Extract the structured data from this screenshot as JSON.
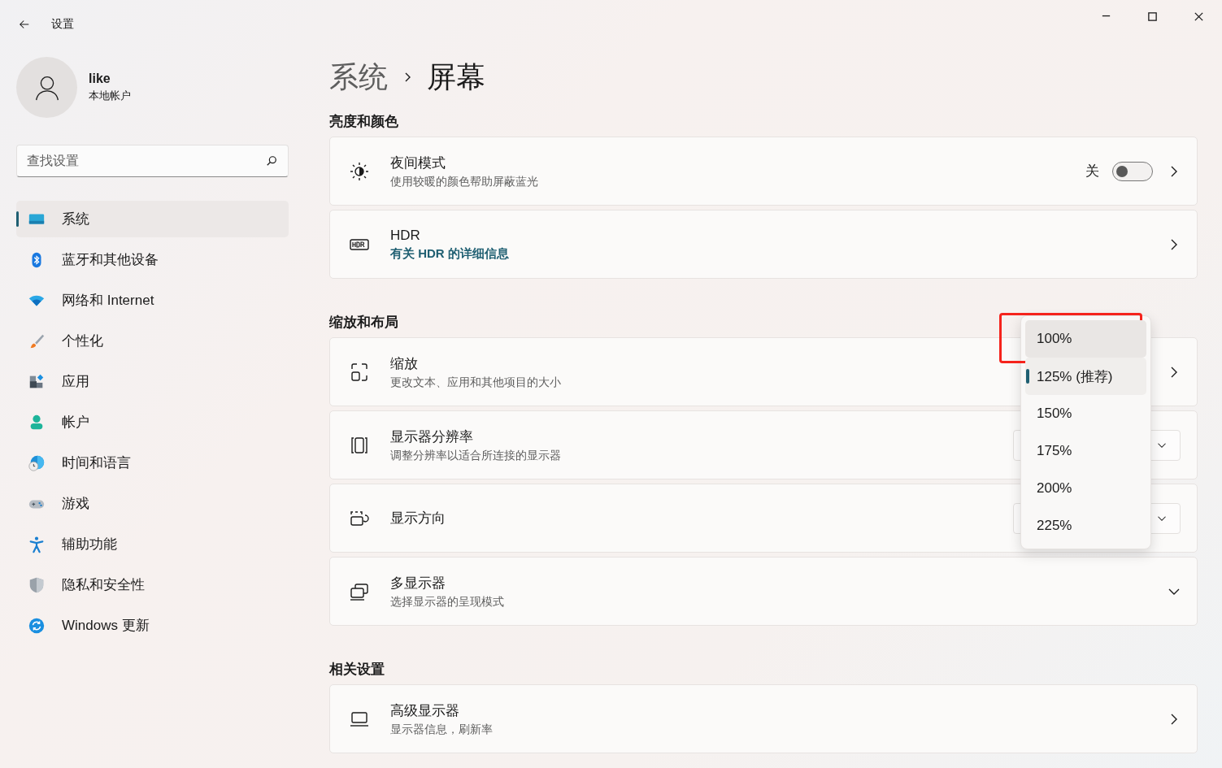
{
  "window": {
    "title": "设置"
  },
  "user": {
    "name": "like",
    "account_type": "本地帐户"
  },
  "search": {
    "placeholder": "查找设置"
  },
  "sidebar": {
    "items": [
      {
        "label": "系统",
        "selected": true
      },
      {
        "label": "蓝牙和其他设备",
        "selected": false
      },
      {
        "label": "网络和 Internet",
        "selected": false
      },
      {
        "label": "个性化",
        "selected": false
      },
      {
        "label": "应用",
        "selected": false
      },
      {
        "label": "帐户",
        "selected": false
      },
      {
        "label": "时间和语言",
        "selected": false
      },
      {
        "label": "游戏",
        "selected": false
      },
      {
        "label": "辅助功能",
        "selected": false
      },
      {
        "label": "隐私和安全性",
        "selected": false
      },
      {
        "label": "Windows 更新",
        "selected": false
      }
    ]
  },
  "breadcrumb": {
    "parent": "系统",
    "current": "屏幕"
  },
  "sections": [
    {
      "heading": "亮度和颜色",
      "cards": [
        {
          "kind": "toggle",
          "title": "夜间模式",
          "subtitle": "使用较暖的颜色帮助屏蔽蓝光",
          "toggle_label": "关",
          "on": false
        },
        {
          "kind": "link",
          "title": "HDR",
          "link": "有关 HDR 的详细信息"
        }
      ]
    },
    {
      "heading": "缩放和布局",
      "cards": [
        {
          "kind": "nav",
          "title": "缩放",
          "subtitle": "更改文本、应用和其他项目的大小"
        },
        {
          "kind": "combo",
          "title": "显示器分辨率",
          "subtitle": "调整分辨率以适合所连接的显示器"
        },
        {
          "kind": "combo",
          "title": "显示方向"
        },
        {
          "kind": "expander",
          "title": "多显示器",
          "subtitle": "选择显示器的呈现模式",
          "expanded": false
        }
      ]
    },
    {
      "heading": "相关设置",
      "cards": [
        {
          "kind": "nav",
          "title": "高级显示器",
          "subtitle": "显示器信息，刷新率"
        }
      ]
    }
  ],
  "scale_menu": {
    "items": [
      {
        "label": "100%",
        "selected": false,
        "hovered": true,
        "annotated": true
      },
      {
        "label": "125% (推荐)",
        "selected": true,
        "hovered": false,
        "annotated": false
      },
      {
        "label": "150%",
        "selected": false,
        "hovered": false,
        "annotated": false
      },
      {
        "label": "175%",
        "selected": false,
        "hovered": false,
        "annotated": false
      },
      {
        "label": "200%",
        "selected": false,
        "hovered": false,
        "annotated": false
      },
      {
        "label": "225%",
        "selected": false,
        "hovered": false,
        "annotated": false
      }
    ]
  }
}
